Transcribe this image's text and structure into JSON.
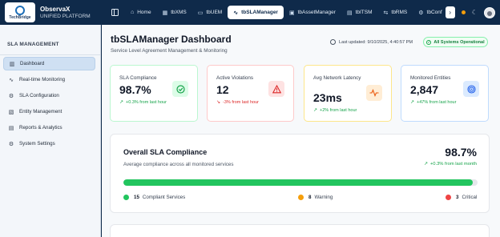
{
  "app": {
    "name": "ObservaX",
    "subtitle": "UNIFIED PLATFORM",
    "logo_text": "TechBridge"
  },
  "tabs": [
    {
      "label": "Home",
      "icon": "home-icon"
    },
    {
      "label": "tbXMS",
      "icon": "grid-icon"
    },
    {
      "label": "tbUEM",
      "icon": "device-icon"
    },
    {
      "label": "tbSLAManager",
      "icon": "pulse-icon",
      "active": true
    },
    {
      "label": "tbAssetManager",
      "icon": "box-icon"
    },
    {
      "label": "tbITSM",
      "icon": "ticket-icon"
    },
    {
      "label": "tbRMS",
      "icon": "remote-icon"
    },
    {
      "label": "tbConf",
      "icon": "gear-icon"
    }
  ],
  "sidebar": {
    "heading": "SLA MANAGEMENT",
    "items": [
      {
        "label": "Dashboard",
        "icon": "dashboard-icon",
        "active": true
      },
      {
        "label": "Real-time Monitoring",
        "icon": "pulse-icon"
      },
      {
        "label": "SLA Configuration",
        "icon": "gear-icon"
      },
      {
        "label": "Entity Management",
        "icon": "entity-icon"
      },
      {
        "label": "Reports & Analytics",
        "icon": "document-icon"
      },
      {
        "label": "System Settings",
        "icon": "gear-icon"
      }
    ]
  },
  "page": {
    "title": "tbSLAManager Dashboard",
    "subtitle": "Service Level Agreement Management & Monitoring",
    "last_updated": "Last updated: 9/10/2025, 4:40:57 PM",
    "status_badge": "All Systems Operational"
  },
  "cards": [
    {
      "label": "SLA Compliance",
      "value": "98.7%",
      "trend": "+0.3% from last hour",
      "trend_dir": "up",
      "icon": "check-circle-icon",
      "color": "#16a34a"
    },
    {
      "label": "Active Violations",
      "value": "12",
      "trend": "-3% from last hour",
      "trend_dir": "down",
      "icon": "warning-icon",
      "color": "#dc2626"
    },
    {
      "label": "Avg Network Latency",
      "value": "23ms",
      "trend": "+2% from last hour",
      "trend_dir": "up",
      "icon": "pulse-icon",
      "color": "#ea580c"
    },
    {
      "label": "Monitored Entities",
      "value": "2,847",
      "trend": "+47% from last hour",
      "trend_dir": "up",
      "icon": "target-icon",
      "color": "#2563eb"
    }
  ],
  "overall": {
    "title": "Overall SLA Compliance",
    "subtitle": "Average compliance across all monitored services",
    "value": "98.7%",
    "trend": "+0.3% from last month",
    "progress": 0.987,
    "legend": [
      {
        "count": "15",
        "label": "Compliant Services",
        "color": "#22c55e"
      },
      {
        "count": "8",
        "label": "Warning",
        "color": "#f59e0b"
      },
      {
        "count": "3",
        "label": "Critical",
        "color": "#ef4444"
      }
    ]
  },
  "colors": {
    "topbar": "#0f2a4a",
    "accent": "#1e6fb8",
    "success": "#22c55e"
  }
}
